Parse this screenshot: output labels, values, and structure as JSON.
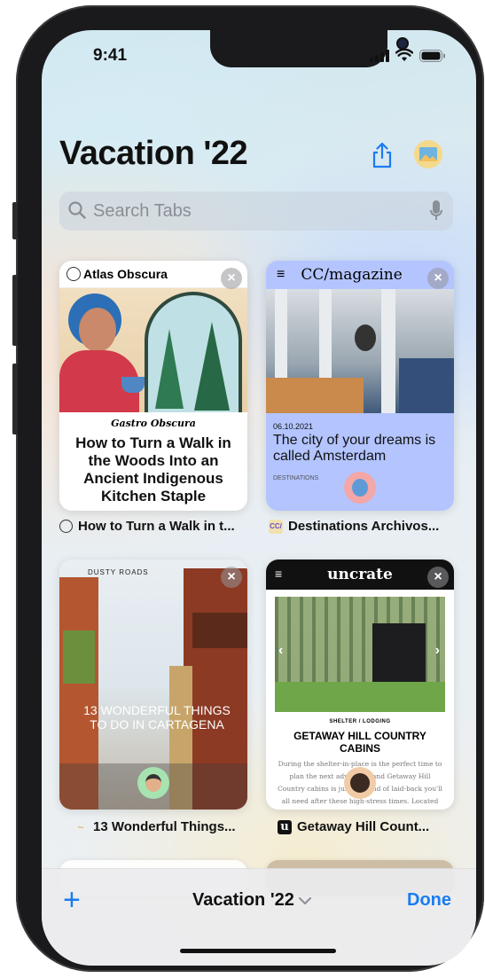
{
  "status": {
    "time": "9:41"
  },
  "header": {
    "title": "Vacation '22"
  },
  "search": {
    "placeholder": "Search Tabs"
  },
  "tabs": [
    {
      "title": "How to Turn a Walk in t...",
      "site": "Atlas Obscura",
      "kicker": "Gastro Obscura",
      "headline": "How to Turn a Walk in the Woods Into an Ancient Indigenous Kitchen Staple"
    },
    {
      "title": "Destinations Archivos...",
      "site": "CC/magazine",
      "date": "06.10.2021",
      "headline": "The city of your dreams is called Amsterdam",
      "category": "DESTINATIONS",
      "favicon_text": "CC/"
    },
    {
      "title": "13 Wonderful Things...",
      "site": "DUSTY ROADS",
      "headline": "13 WONDERFUL THINGS TO DO IN CARTAGENA"
    },
    {
      "title": "Getaway Hill Count...",
      "site": "uncrate",
      "category": "SHELTER / LODGING",
      "headline": "GETAWAY HILL COUNTRY CABINS",
      "body": "During the shelter-in-place is the perfect time to plan the next adventure and Getaway Hill Country cabins is just the kind of laid-back you'll all need after these high-stress times. Located just",
      "favicon_text": "u"
    }
  ],
  "toolbar": {
    "group_label": "Vacation '22",
    "done_label": "Done",
    "add_label": "+"
  },
  "colors": {
    "accent": "#1a7cf0"
  }
}
